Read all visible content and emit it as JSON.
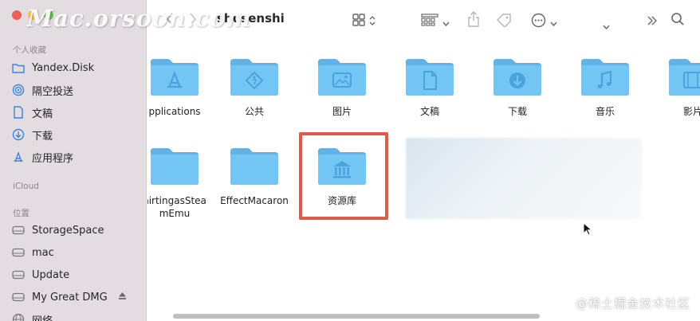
{
  "window": {
    "title": "shusenshi",
    "watermark": "Mac.orsoon.com",
    "credit": "@稀土掘金技术社区"
  },
  "sidebar": {
    "favorites": {
      "header": "个人收藏",
      "items": [
        {
          "label": "Yandex.Disk",
          "icon": "folder-icon"
        },
        {
          "label": "隔空投送",
          "icon": "airdrop-icon"
        },
        {
          "label": "文稿",
          "icon": "document-icon"
        },
        {
          "label": "下载",
          "icon": "download-icon"
        },
        {
          "label": "应用程序",
          "icon": "applications-icon"
        }
      ]
    },
    "icloud": {
      "header": "iCloud"
    },
    "locations": {
      "header": "位置",
      "items": [
        {
          "label": "StorageSpace",
          "icon": "drive-icon"
        },
        {
          "label": "mac",
          "icon": "drive-icon"
        },
        {
          "label": "Update",
          "icon": "drive-icon"
        },
        {
          "label": "My Great DMG",
          "icon": "drive-icon",
          "eject": true
        },
        {
          "label": "网络",
          "icon": "network-icon"
        }
      ]
    }
  },
  "content": {
    "items": [
      {
        "label": "pplications",
        "glyph": "apps"
      },
      {
        "label": "公共",
        "glyph": "public"
      },
      {
        "label": "图片",
        "glyph": "pictures"
      },
      {
        "label": "文稿",
        "glyph": "document"
      },
      {
        "label": "下载",
        "glyph": "download"
      },
      {
        "label": "音乐",
        "glyph": "music"
      },
      {
        "label": "影片",
        "glyph": "movies"
      },
      {
        "label": "hirtingasStea\nmEmu",
        "glyph": ""
      },
      {
        "label": "EffectMacaron",
        "glyph": ""
      },
      {
        "label": "资源库",
        "glyph": "library"
      }
    ],
    "highlighted": "资源库"
  },
  "colors": {
    "folder_light": "#6fc2f3",
    "folder_tab": "#5fb3ea",
    "highlight": "#dd5a4e",
    "sidebar_bg": "#e3dde2"
  }
}
